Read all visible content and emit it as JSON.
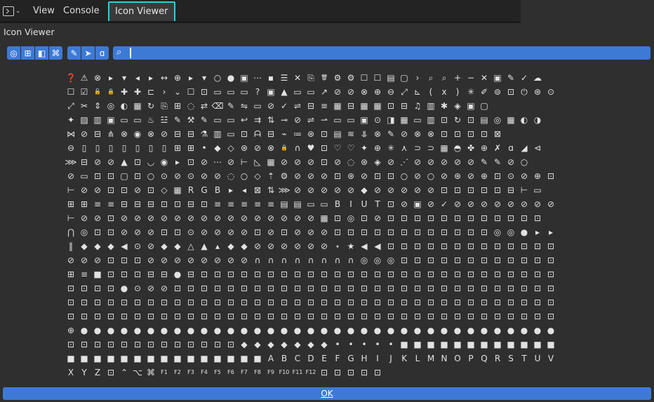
{
  "header": {
    "editor_type": "console-editor-icon",
    "menus": [
      {
        "label": "View"
      },
      {
        "label": "Console"
      },
      {
        "label": "Icon Viewer",
        "active": true
      }
    ]
  },
  "panel": {
    "title": "Icon Viewer"
  },
  "toolbar": {
    "left_group": [
      "blender-icon",
      "object-icon",
      "mode-icon",
      "keyboard-icon"
    ],
    "right_group": [
      "brush-icon",
      "cursor-icon",
      "text-icon"
    ],
    "search_icon": "search-icon",
    "search_value": ""
  },
  "icon_grid": {
    "rows": [
      "❓⚠⊗▸▾◂▸↔⊕▸▾○●▣⋯▪☰✕⎘🗑⚙⚙☐☐▤▢›⌕⌕+−✕▣✎✓☁",
      "☐☑🔓🔒✚✚⊏›⌄☐⊡▭▭▭?▣▲▭▭↗⊘⊘⊗⊕⊖⤢⊾(x)✳✐⊚⊡⏻⊛⊙⋮",
      "⤢✂⇕◎◐▦↻⎘⊞◌⇄⌫✎⇋▭⊘✓⇌⊟≡▦⊟▦▦⊡⊟♫▥✱◈▣▢",
      "✦▨▥▣▭▭♨☳✎⚒✎▭▭↩⇉⇅⊸⊘⇌⇀▭▭▣⊙◨▦▭▥⊡↻⊡▤◎▦◐◑",
      "⋈⊘⊟⋔⊗◉⊗⊘⊟⊟⚗▥▭⊡ᗩ⊟⌁≔⊛⊡▤≋⥥⊗✎⊘⊗⊗⊡⊡⊡⊡⊠",
      "⊖▯▯▯▯▯▯▯⊞⊞•◆◇⊛⊘⊗🔒∩♥⊡♡♡✦⊕✳⋏⊃⊃▦◓✤⊕✗ɑ◢⊲",
      "⋙⊟⊘⊘▲⊡◡◉▸⊡⊘⋯⊘⊢◺▦⊘⊘⊘⊡⊘◌⊛◈⊘⋰⊘⊘⊘⊘⊘✎✎⊘○",
      "⊘▭⊡⊡▢⊡○⊙⊘⊙⊘⊘◌○◇⇡⚙⊘⊘⊘⊡⊛⊘⊡⊡○⊘○⊘⊛⊘⊕⊡⊙⊘⊕⊡",
      "⊢⊘⊘⊡⊡⊘⊡◇▦RGB▸◂⊠⇅⋙⊘⊘⊘⊘⊘◆⊘⊘⊘⊘⊘⊡⊡⊡⊡⊡⊟⊢▭",
      "⊞⊞≡≡⊟⊟⊟⊡⊡⊟⊡≡≡≡≡≡▤▤▭▭BIUT⊡⊘▣⊘✓⊘⊘⊘⊘⊘⊘⊘⊘⊘",
      "⊢⊘⊘⊡⊘⊘⊘⊘⊘⊘⊘⊘⊘⊘⊘⊘⊘⊘⊘▦⊡◎⊡⊘⊡⊡⊡⊡⊡⊡⊡⊡⊡⊡⊡⊡",
      "⋂◎⊡⊡⊘⊘⊘⊡⊡⊙⊘⊘⊘⊘⊡⊘⊡⊘⊘⊘⊡⊡⊡⊡⊡⊡⊡⊡⊡⊡⊡⊡◎◎●▸▸▸",
      "‖◆◆◆◀⊙⊘◆◆△▲▴◆◆⊘⊘⊘⊘⊘⊘⋆★◀◀⊡⊡⊡⊡⊡⊡⊡⊡⊡⊡⊡⊡⊡⊡",
      "⊘⊘⊘⊡⊡⊡⊘⊘⊘⊘⊘⊘⊘⊘∩∩∩∩∩∩∩∩◎◎◎⊡⊡⊡⊡⊡⊡⊡⊡⊡⊡⊡⊡",
      "⊞≡■⊡⊡⊡⊟⊟●⊟⊡⊡⊡⊡⊡⊡⊡⊡⊡⊡⊡⊡⊡⊡⊡⊡⊡⊡⊡⊡⊡⊡⊡⊡⊡⊡⊡",
      "⊡⊡⊡⊡●⊙⊘⊘⊡⊡⊡⊡⊡⊡⊡⊡⊡⊡⊡⊡⊡⊡⊡⊡⊡⊡⊡⊡⊡⊡⊡⊡⊡⊡⊡⊡⊡",
      "⊡⊡⊡⊡⊡⊡⊡⊡⊡⊡⊡⊡⊡⊡⊡⊡⊡⊡⊡⊡⊡⊡⊡⊡⊡⊡⊡⊡⊡⊡⊡⊡⊡⊡⊡⊡⊡",
      "⊡⊡⊡⊡⊡⊡⊡⊡⊡⊡⊡⊡⊡⊡⊡⊡⊡⊡⊡⊡⊡⊡⊡⊡⊡⊡⊡⊡⊡⊡⊡⊡⊡⊡⊡⊡⊡",
      "⊕●●●●●●●●●●●●●●●●●●●●●●●●●●●●●●●●●●●●",
      "⊡⊡⊡⊡⊡⊡⊡⊡⊡⊡⊡⊡⊡◆◆◆◆◆◆◆•••••■■■■■■■■■■■■",
      "■■■■■■■■■■■■■■■ABCDEFGHIJKLMNOPQRSTUVW",
      "XYZ⊡⌃⌥⌘F1F2F3F4F5F6F7F8F9F10F11F12⊡⊡⊡⊡⊡"
    ]
  },
  "footer": {
    "ok_label": "OK"
  },
  "colors": {
    "accent": "#3d7ad6",
    "highlight": "#21d4dc",
    "background": "#2f2f2f"
  }
}
